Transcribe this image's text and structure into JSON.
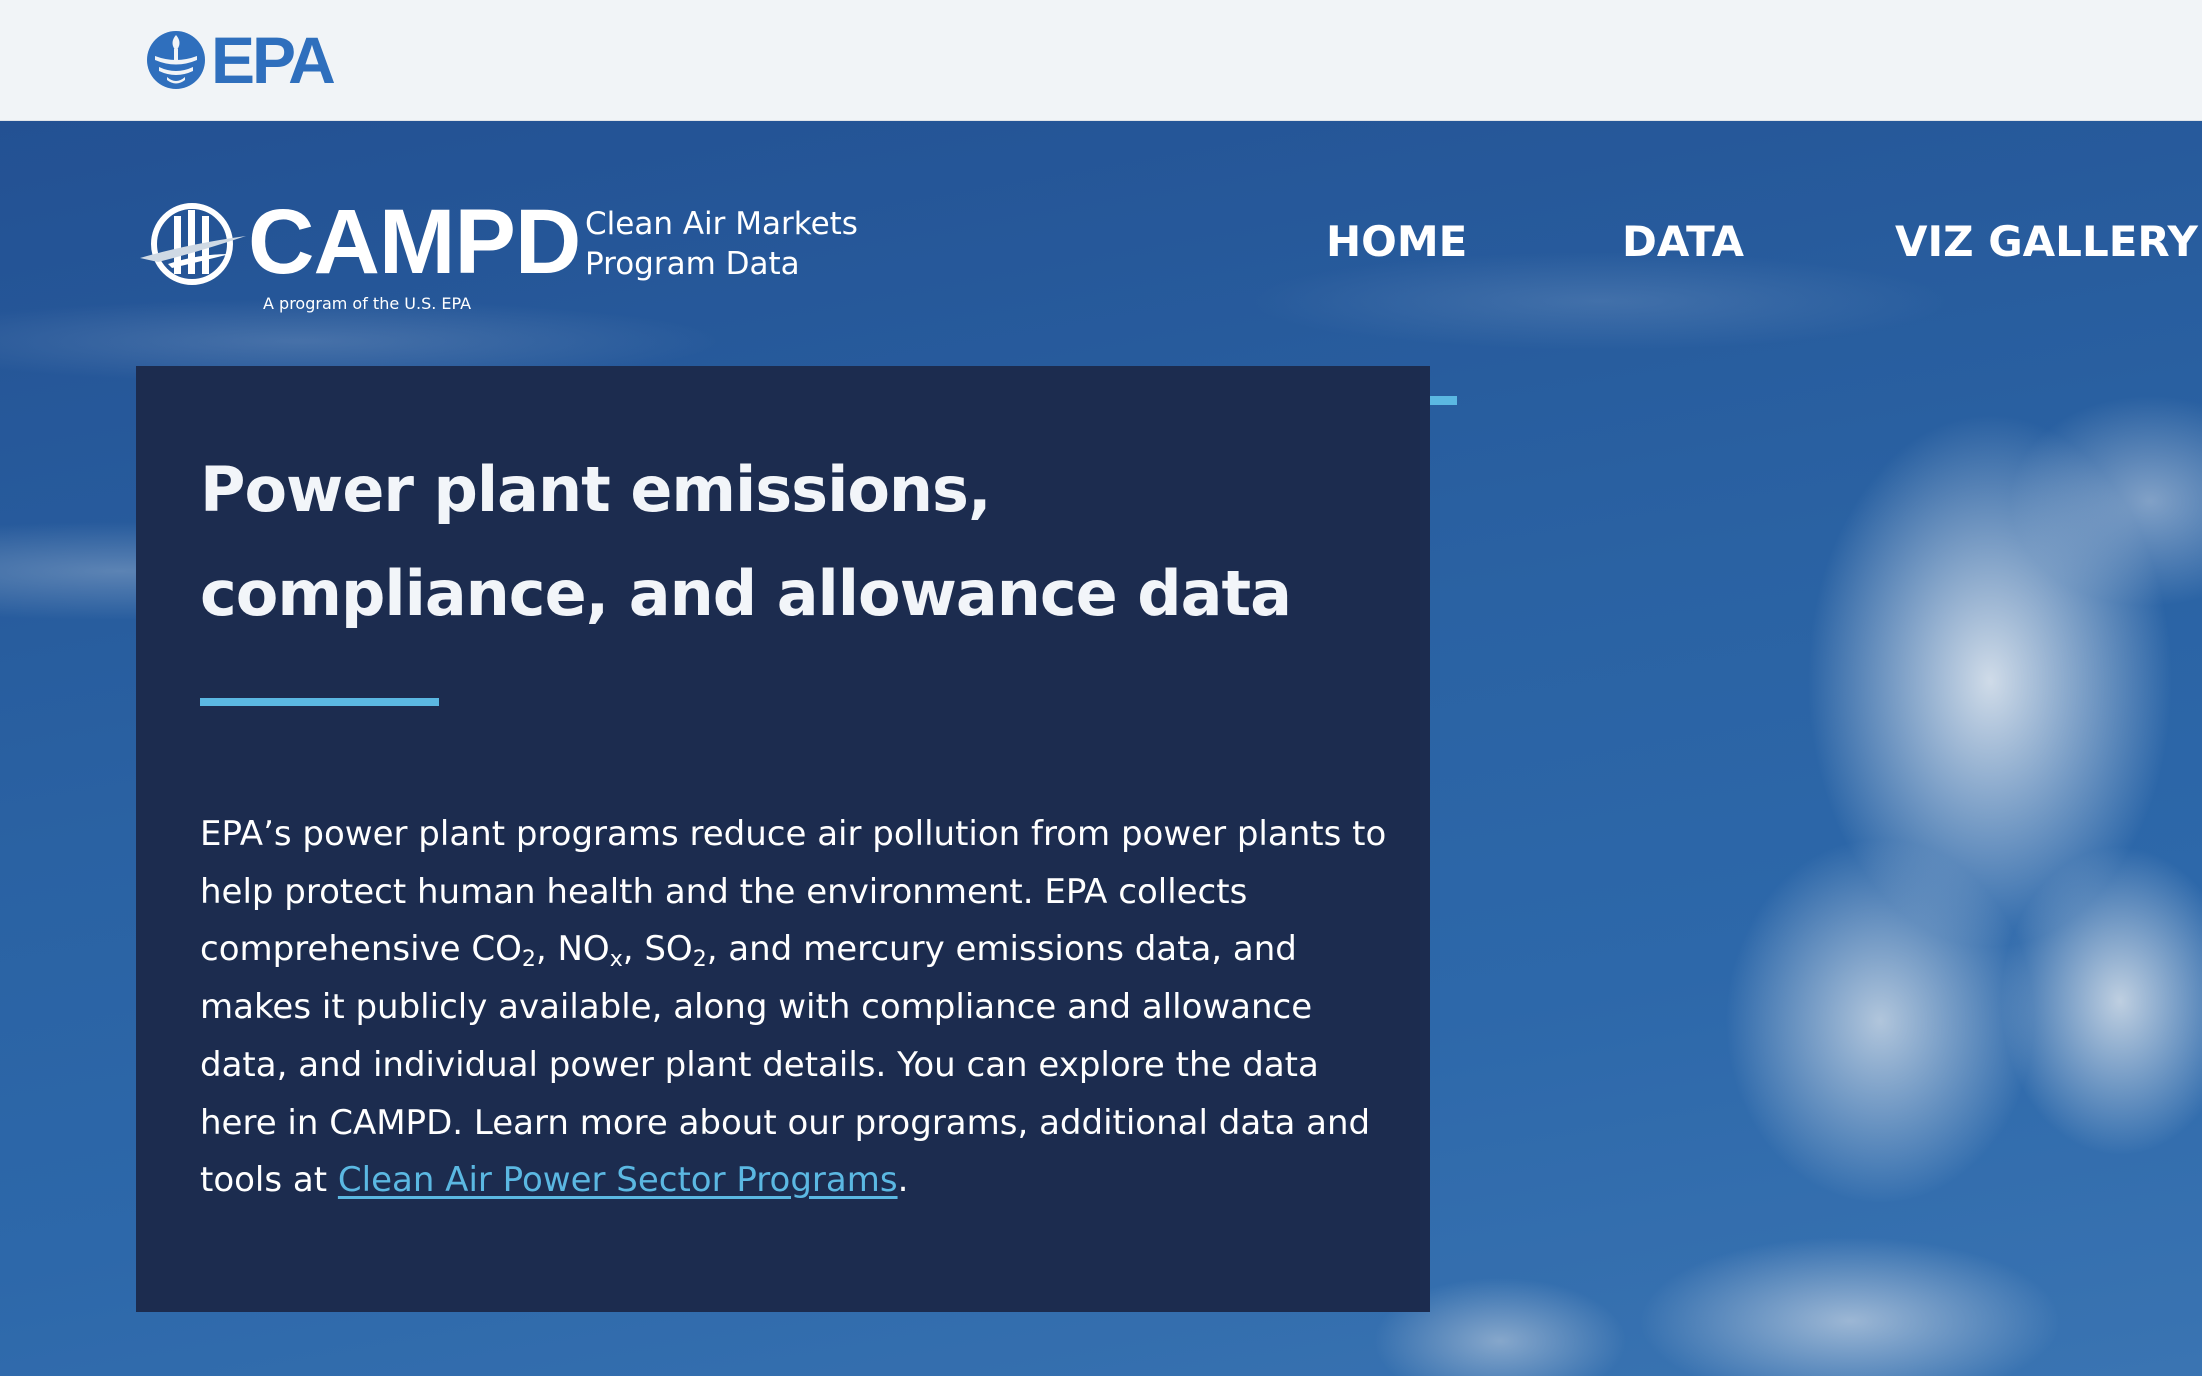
{
  "epa_header": {
    "logo_text": "EPA",
    "logo_icon": "epa-seal-icon"
  },
  "campd": {
    "logo_icon": "campd-globe-icon",
    "wordmark": "CAMPD",
    "subtitle_line1": "Clean Air Markets",
    "subtitle_line2": "Program Data",
    "tagline": "A program of the U.S. EPA"
  },
  "nav": {
    "items": [
      {
        "label": "HOME",
        "active": true
      },
      {
        "label": "DATA",
        "active": false
      },
      {
        "label": "VIZ GALLERY",
        "active": false
      }
    ]
  },
  "hero": {
    "title": "Power plant emissions, compliance, and allowance data",
    "body": {
      "part1": "EPA’s power plant programs reduce air pollution from power plants to help protect human health and the environment. EPA collects comprehensive CO",
      "sub1": "2",
      "part2": ", NO",
      "sub2": "x",
      "part3": ", SO",
      "sub3": "2",
      "part4": ", and mercury emissions data, and makes it publicly available, along with compliance and allowance data, and individual power plant details. You can explore the data here in CAMPD. Learn more about our programs, additional data and tools at ",
      "link_text": "Clean Air Power Sector Programs",
      "end": "."
    }
  },
  "colors": {
    "epa_blue": "#2f6fbd",
    "accent": "#5bb8e2",
    "card_bg": "#1c2c4f",
    "sky": "#235592"
  }
}
